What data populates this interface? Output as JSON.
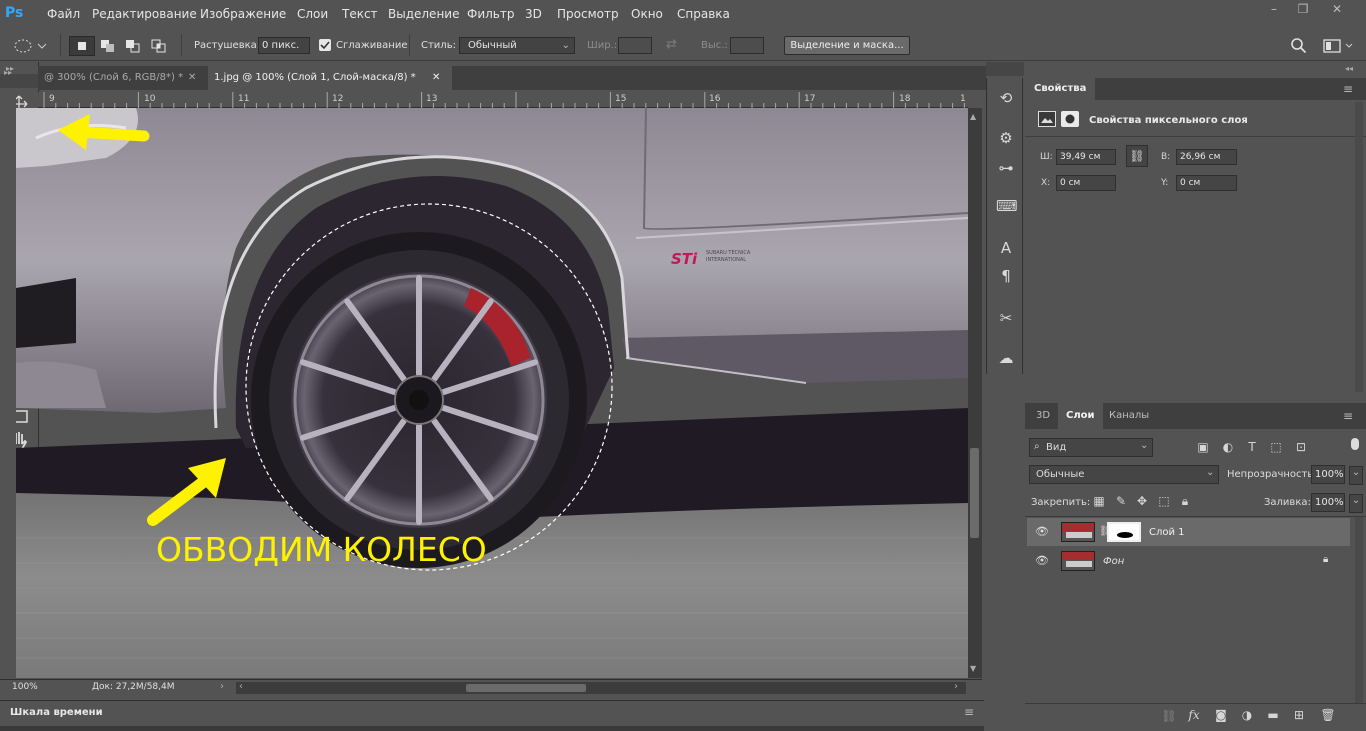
{
  "app": {
    "logo": "Ps"
  },
  "menu": [
    "Файл",
    "Редактирование",
    "Изображение",
    "Слои",
    "Текст",
    "Выделение",
    "Фильтр",
    "3D",
    "Просмотр",
    "Окно",
    "Справка"
  ],
  "window_controls": [
    "–",
    "❐",
    "✕"
  ],
  "options": {
    "feather_label": "Растушевка:",
    "feather_value": "0 пикс.",
    "antialias_label": "Сглаживание",
    "style_label": "Стиль:",
    "style_value": "Обычный",
    "width_label": "Шир.:",
    "height_label": "Выс.:",
    "select_mask_button": "Выделение и маска..."
  },
  "tabs": [
    {
      "label": "@ 300% (Слой 6, RGB/8*) *",
      "active": false
    },
    {
      "label": "1.jpg @ 100% (Слой 1, Слой-маска/8) *",
      "active": true
    }
  ],
  "ruler": {
    "numbers": [
      "9",
      "10",
      "11",
      "12",
      "13",
      "15",
      "16",
      "17",
      "18",
      "1"
    ]
  },
  "canvas": {
    "annotation_text": "ОБВОДИМ КОЛЕСО",
    "annotation_color": "#fff200",
    "badge": "STi",
    "badge_sub1": "SUBARU TECNICA",
    "badge_sub2": "INTERNATIONAL"
  },
  "status": {
    "zoom": "100%",
    "doc": "Док: 27,2M/58,4M"
  },
  "timeline": {
    "label": "Шкала времени"
  },
  "properties": {
    "tab": "Свойства",
    "subtitle": "Свойства пиксельного слоя",
    "w_label": "Ш:",
    "w_value": "39,49 см",
    "h_label": "В:",
    "h_value": "26,96 см",
    "x_label": "X:",
    "x_value": "0 см",
    "y_label": "Y:",
    "y_value": "0 см"
  },
  "layers_panel": {
    "tabs": [
      "3D",
      "Слои",
      "Каналы"
    ],
    "filter_value": "Вид",
    "blend_mode": "Обычные",
    "opacity_label": "Непрозрачность:",
    "opacity_value": "100%",
    "lock_label": "Закрепить:",
    "fill_label": "Заливка:",
    "fill_value": "100%",
    "layers": [
      {
        "name": "Слой 1",
        "selected": true
      },
      {
        "name": "Фон",
        "selected": false
      }
    ],
    "footer_fx": "fx"
  }
}
